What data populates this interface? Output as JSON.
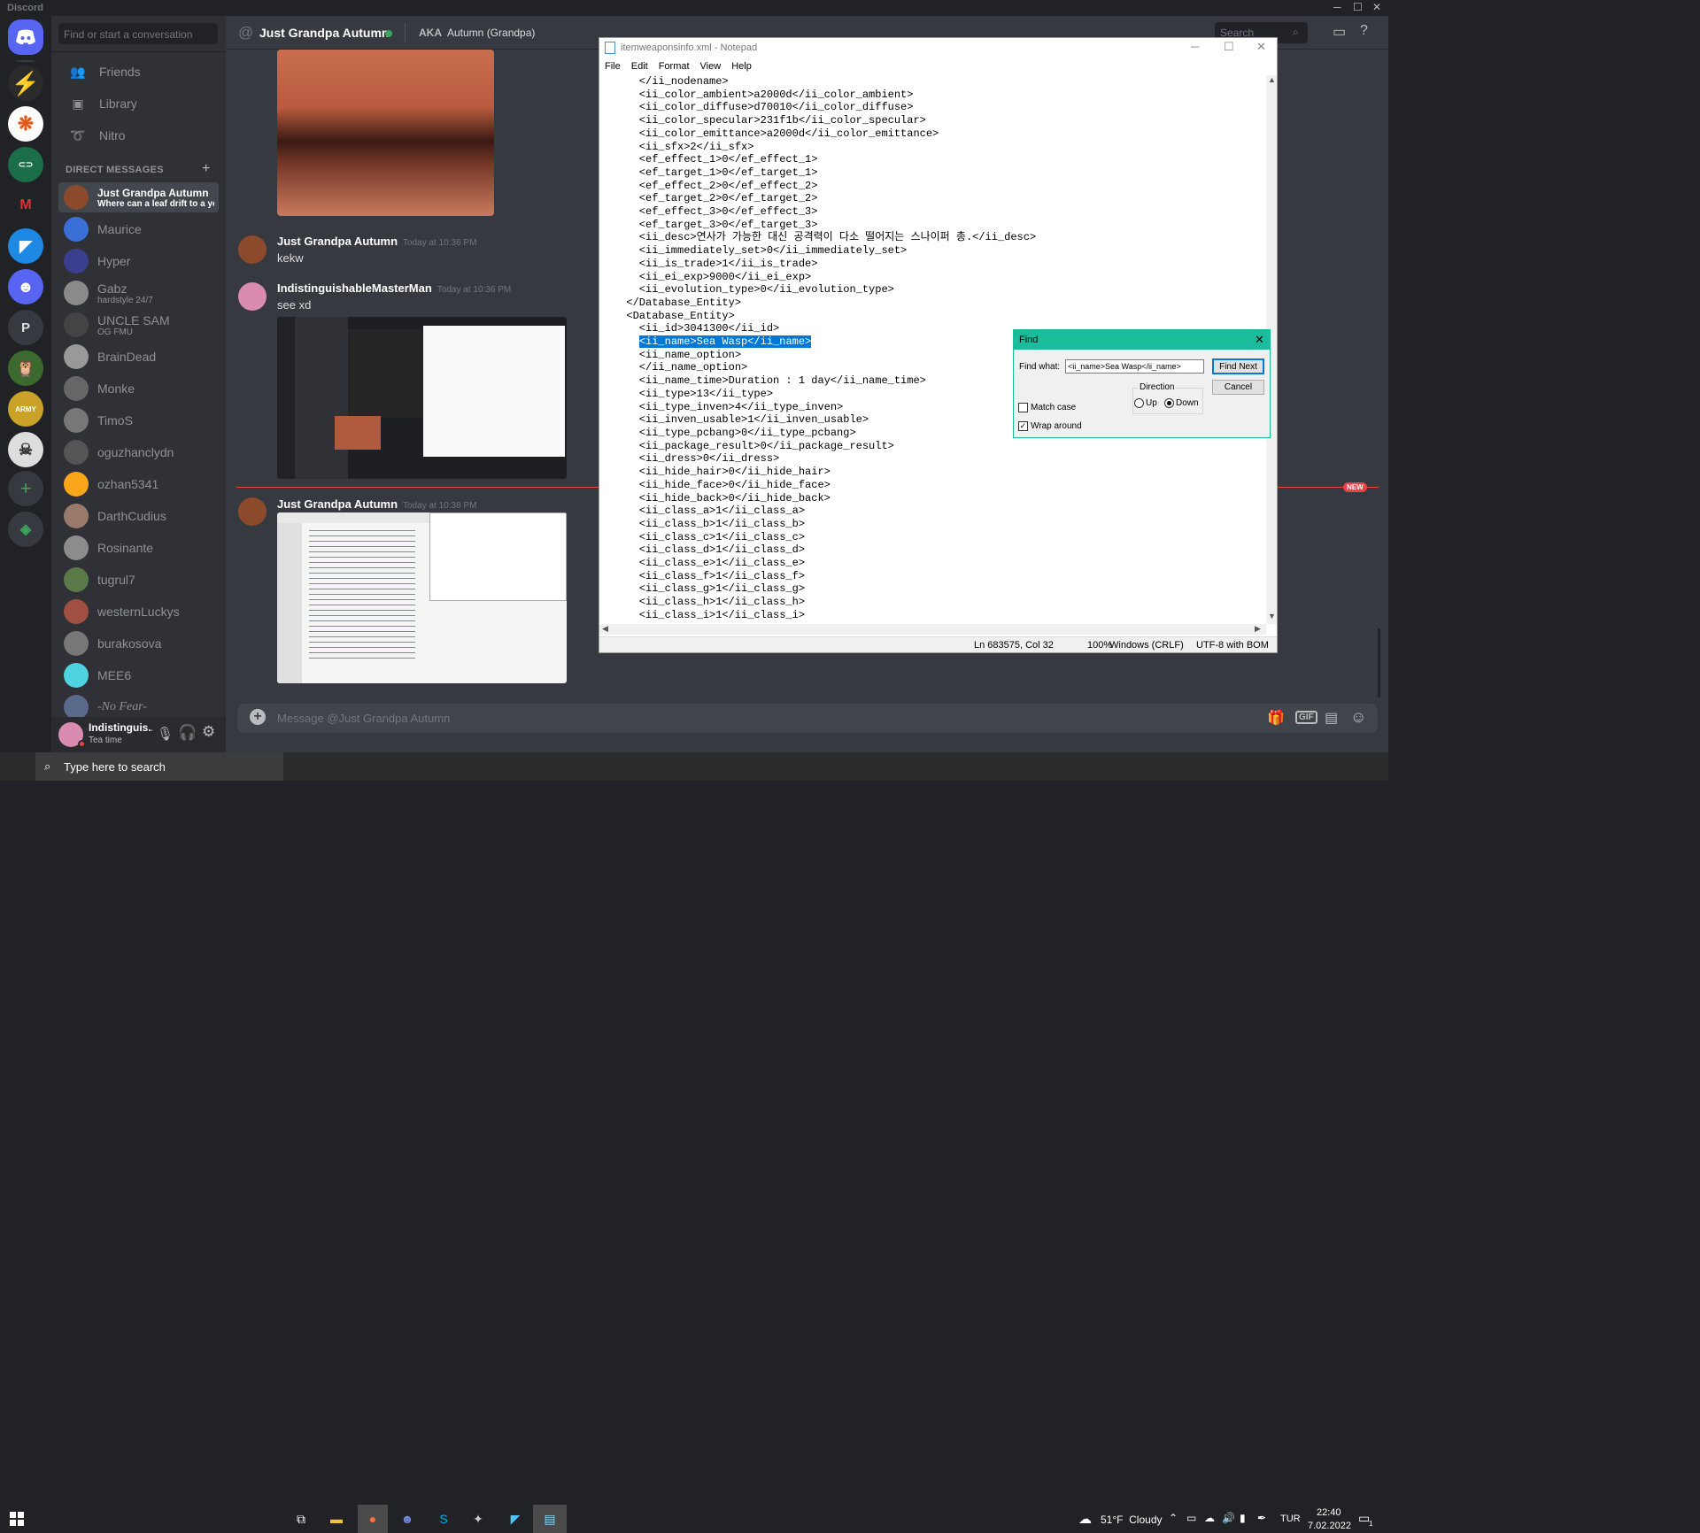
{
  "window": {
    "title": "Discord"
  },
  "dm_search": {
    "placeholder": "Find or start a conversation"
  },
  "nav": [
    {
      "label": "Friends"
    },
    {
      "label": "Library"
    },
    {
      "label": "Nitro"
    }
  ],
  "direct_messages_header": "DIRECT MESSAGES",
  "dms": [
    {
      "name": "Just Grandpa Autumn",
      "sub": "Where can a leaf drift to a ye...",
      "color": "#8b4a2b",
      "active": true
    },
    {
      "name": "Maurice",
      "sub": "",
      "color": "#3a6fd8"
    },
    {
      "name": "Hyper",
      "sub": "",
      "color": "#3b3f8f"
    },
    {
      "name": "Gabz",
      "sub": "hardstyle 24/7",
      "color": "#8a8a8a"
    },
    {
      "name": "UNCLE SAM",
      "sub": "OG FMU",
      "color": "#444"
    },
    {
      "name": "BrainDead",
      "sub": "",
      "color": "#999"
    },
    {
      "name": "Monke",
      "sub": "",
      "color": "#666"
    },
    {
      "name": "TimoS",
      "sub": "",
      "color": "#777"
    },
    {
      "name": "oguzhanclydn",
      "sub": "",
      "color": "#555"
    },
    {
      "name": "ozhan5341",
      "sub": "",
      "color": "#faa61a"
    },
    {
      "name": "DarthCudius",
      "sub": "",
      "color": "#9a7b6b"
    },
    {
      "name": "Rosinante",
      "sub": "",
      "color": "#8c8c8c"
    },
    {
      "name": "tugrul7",
      "sub": "",
      "color": "#5a7a4a"
    },
    {
      "name": "westernLuckys",
      "sub": "",
      "color": "#a05040"
    },
    {
      "name": "burakosova",
      "sub": "",
      "color": "#777"
    },
    {
      "name": "MEE6",
      "sub": "",
      "color": "#4ed4e0"
    },
    {
      "name": "-No Fear-",
      "sub": "",
      "color": "#5a6a8a"
    }
  ],
  "user_panel": {
    "name": "Indistinguis...",
    "status": "Tea time"
  },
  "chat_header": {
    "name": "Just Grandpa Autumn",
    "aka_label": "AKA",
    "aka": "Autumn (Grandpa)",
    "search_placeholder": "Search"
  },
  "messages": [
    {
      "author": "Just Grandpa Autumn",
      "time": "Today at 10:36 PM",
      "text": "kekw"
    },
    {
      "author": "IndistinguishableMasterMan",
      "time": "Today at 10:36 PM",
      "text": "see xd"
    },
    {
      "author": "Just Grandpa Autumn",
      "time": "Today at 10:38 PM",
      "text": ""
    }
  ],
  "new_badge": "NEW",
  "composer": {
    "placeholder": "Message @Just Grandpa Autumn"
  },
  "notepad": {
    "title": "itemweaponsinfo.xml - Notepad",
    "menu": [
      "File",
      "Edit",
      "Format",
      "View",
      "Help"
    ],
    "lines": [
      "    </ii_nodename>",
      "    <ii_color_ambient>a2000d</ii_color_ambient>",
      "    <ii_color_diffuse>d70010</ii_color_diffuse>",
      "    <ii_color_specular>231f1b</ii_color_specular>",
      "    <ii_color_emittance>a2000d</ii_color_emittance>",
      "    <ii_sfx>2</ii_sfx>",
      "    <ef_effect_1>0</ef_effect_1>",
      "    <ef_target_1>0</ef_target_1>",
      "    <ef_effect_2>0</ef_effect_2>",
      "    <ef_target_2>0</ef_target_2>",
      "    <ef_effect_3>0</ef_effect_3>",
      "    <ef_target_3>0</ef_target_3>",
      "    <ii_desc>연사가 가능한 대신 공격력이 다소 떨어지는 스나이퍼 총.</ii_desc>",
      "    <ii_immediately_set>0</ii_immediately_set>",
      "    <ii_is_trade>1</ii_is_trade>",
      "    <ii_ei_exp>9000</ii_ei_exp>",
      "    <ii_evolution_type>0</ii_evolution_type>",
      "  </Database_Entity>",
      "  <Database_Entity>",
      "    <ii_id>3041300</ii_id>",
      "    <ii_name>Sea Wasp</ii_name>",
      "    <ii_name_option>",
      "    </ii_name_option>",
      "    <ii_name_time>Duration : 1 day</ii_name_time>",
      "    <ii_type>13</ii_type>",
      "    <ii_type_inven>4</ii_type_inven>",
      "    <ii_inven_usable>1</ii_inven_usable>",
      "    <ii_type_pcbang>0</ii_type_pcbang>",
      "    <ii_package_result>0</ii_package_result>",
      "    <ii_dress>0</ii_dress>",
      "    <ii_hide_hair>0</ii_hide_hair>",
      "    <ii_hide_face>0</ii_hide_face>",
      "    <ii_hide_back>0</ii_hide_back>",
      "    <ii_class_a>1</ii_class_a>",
      "    <ii_class_b>1</ii_class_b>",
      "    <ii_class_c>1</ii_class_c>",
      "    <ii_class_d>1</ii_class_d>",
      "    <ii_class_e>1</ii_class_e>",
      "    <ii_class_f>1</ii_class_f>",
      "    <ii_class_g>1</ii_class_g>",
      "    <ii_class_h>1</ii_class_h>",
      "    <ii_class_i>1</ii_class_i>"
    ],
    "highlighted_line_index": 20,
    "status": {
      "position": "Ln 683575, Col 32",
      "zoom": "100%",
      "eol": "Windows (CRLF)",
      "encoding": "UTF-8 with BOM"
    }
  },
  "find_dialog": {
    "title": "Find",
    "find_what_label": "Find what:",
    "find_what_value": "<ii_name>Sea Wasp</ii_name>",
    "find_next": "Find Next",
    "cancel": "Cancel",
    "direction_label": "Direction",
    "up": "Up",
    "down": "Down",
    "match_case": "Match case",
    "wrap_around": "Wrap around"
  },
  "taskbar": {
    "search_placeholder": "Type here to search",
    "weather": "51°F  Cloudy",
    "language": "TUR",
    "time": "22:40",
    "date": "7.02.2022",
    "notification_count": "1"
  },
  "colors": {
    "discord_blurple": "#5865f2",
    "find_accent": "#1bbc9b",
    "selection": "#0078d7",
    "new_red": "#ed4245",
    "online": "#3ba55d"
  }
}
